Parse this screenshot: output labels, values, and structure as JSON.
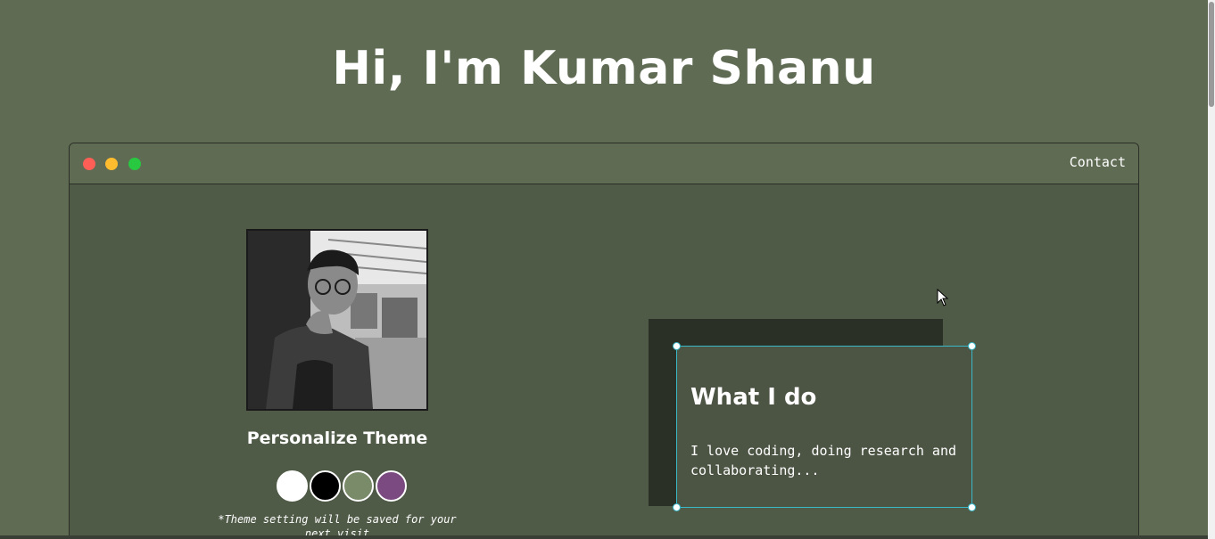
{
  "header": {
    "title": "Hi, I'm Kumar Shanu"
  },
  "window": {
    "controls": [
      "close",
      "minimize",
      "maximize"
    ],
    "nav": {
      "contact_label": "Contact"
    }
  },
  "profile": {
    "photo_alt": "Kumar Shanu"
  },
  "theme": {
    "heading": "Personalize Theme",
    "swatches": [
      {
        "name": "white",
        "color": "#ffffff"
      },
      {
        "name": "black",
        "color": "#000000"
      },
      {
        "name": "sage",
        "color": "#7a8b6a"
      },
      {
        "name": "purple",
        "color": "#7a4a80"
      }
    ],
    "note": "*Theme setting will be saved for your next visit"
  },
  "card": {
    "title": "What I do",
    "text": "I love coding, doing research and collaborating..."
  },
  "colors": {
    "page_bg": "#5f6b53",
    "window_bg": "#4f5a47",
    "selection": "#38b8c8"
  }
}
